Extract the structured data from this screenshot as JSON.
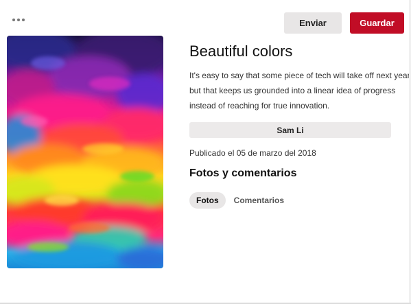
{
  "header": {
    "more_icon": "more-horizontal-icon",
    "send_label": "Enviar",
    "save_label": "Guardar",
    "accent_color": "#c10d26"
  },
  "pin": {
    "image_alt": "colorful abstract powder clouds",
    "title": "Beautiful colors",
    "description": "It's easy to say that some piece of tech will take off next year but that keeps us grounded into a linear idea of progress instead of reaching for true innovation.",
    "author": "Sam Li",
    "published": "Publicado el 05 de marzo del 2018"
  },
  "comments_section": {
    "heading": "Fotos y comentarios",
    "tabs": [
      {
        "label": "Fotos",
        "active": true
      },
      {
        "label": "Comentarios",
        "active": false
      }
    ]
  }
}
